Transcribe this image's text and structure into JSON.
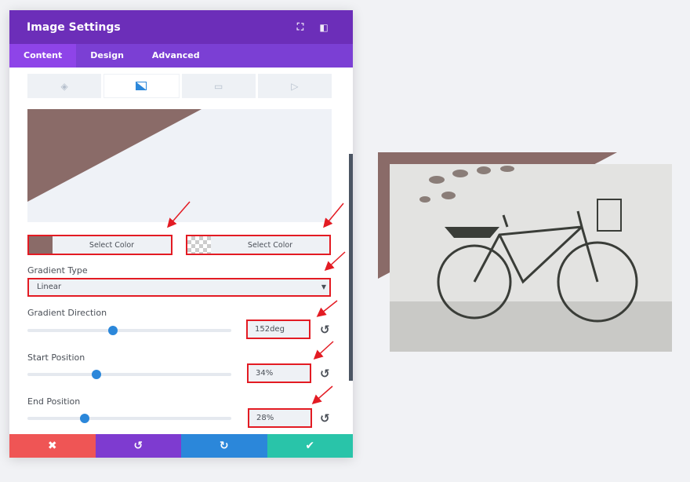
{
  "header": {
    "title": "Image Settings",
    "icons": [
      "fullscreen-icon",
      "split-view-icon"
    ]
  },
  "tabs": [
    {
      "label": "Content",
      "active": true
    },
    {
      "label": "Design"
    },
    {
      "label": "Advanced"
    }
  ],
  "background_tabs": [
    "color-fill-icon",
    "gradient-icon",
    "image-icon",
    "video-icon"
  ],
  "colors": {
    "start_color": "#8a6b68",
    "accent": "#2b87da",
    "header": "#6c2eb9"
  },
  "color_pickers": [
    {
      "label": "Select Color"
    },
    {
      "label": "Select Color"
    }
  ],
  "gradient_type": {
    "label": "Gradient Type",
    "value": "Linear"
  },
  "gradient_direction": {
    "label": "Gradient Direction",
    "value": "152deg",
    "fraction": 0.42
  },
  "start_position": {
    "label": "Start Position",
    "value": "34%",
    "fraction": 0.34
  },
  "end_position": {
    "label": "End Position",
    "value": "28%",
    "fraction": 0.28
  },
  "footer": [
    "cancel-icon",
    "undo-icon",
    "redo-icon",
    "save-check-icon"
  ]
}
